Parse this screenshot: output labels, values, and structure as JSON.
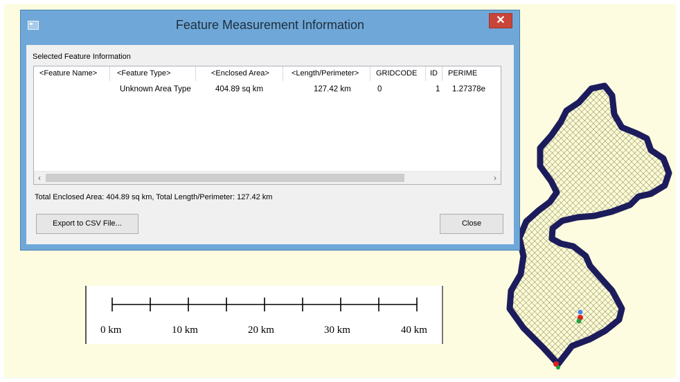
{
  "dialog": {
    "title": "Feature Measurement Information",
    "close_glyph": "✕",
    "group_label": "Selected Feature Information",
    "columns": [
      "<Feature Name>",
      "<Feature Type>",
      "<Enclosed Area>",
      "<Length/Perimeter>",
      "GRIDCODE",
      "ID",
      "PERIME"
    ],
    "rows": [
      {
        "name": "",
        "type": "Unknown Area Type",
        "area": "404.89 sq km",
        "length": "127.42 km",
        "gridcode": "0",
        "id": "1",
        "perimeter": "1.27378e"
      }
    ],
    "scroll_left": "‹",
    "scroll_right": "›",
    "total_text": "Total Enclosed Area: 404.89 sq km, Total Length/Perimeter: 127.42 km",
    "export_label": "Export to CSV File...",
    "close_label": "Close"
  },
  "scale_bar": {
    "labels": [
      "0 km",
      "10 km",
      "20 km",
      "30 km",
      "40 km"
    ]
  },
  "colors": {
    "title_bar": "#6fa8d8",
    "close_button": "#c9453a",
    "map_background": "#fdfce0",
    "outline": "#1c1c5c",
    "hatch": "#7a7a50"
  }
}
